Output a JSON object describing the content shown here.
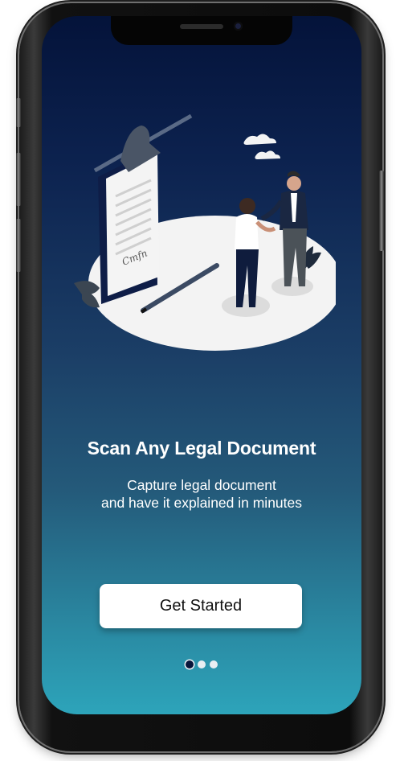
{
  "onboarding": {
    "title": "Scan Any Legal Document",
    "subtitle": "Capture  legal document\nand have it explained in minutes",
    "cta_label": "Get Started",
    "page_indicator": {
      "total": 3,
      "active_index": 0
    }
  },
  "illustration": {
    "signature_text": "Cmfn",
    "icons": [
      "clipboard-document-icon",
      "pen-icon",
      "handshake-people-icon",
      "cloud-icon",
      "plant-icon"
    ]
  },
  "colors": {
    "gradient_top": "#04133a",
    "gradient_bottom": "#2da4ba",
    "button_bg": "#ffffff",
    "dot_active": "#08153a",
    "dot_inactive": "#e9eef2"
  }
}
